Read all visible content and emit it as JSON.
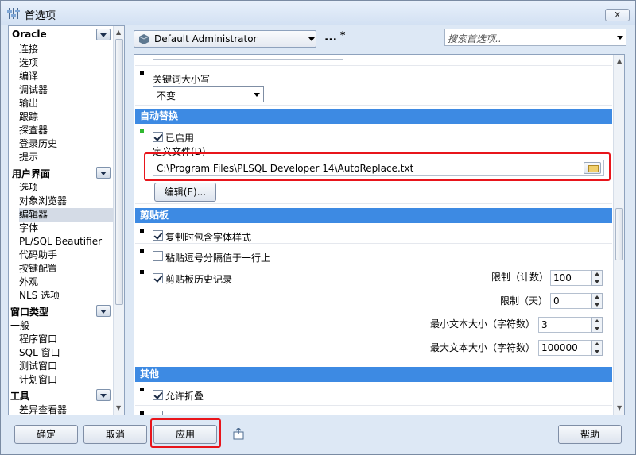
{
  "window": {
    "title": "首选项",
    "close": "x"
  },
  "tree": {
    "groups": [
      {
        "label": "Oracle",
        "items": [
          "连接",
          "选项",
          "编译",
          "调试器",
          "输出",
          "跟踪",
          "探查器",
          "登录历史",
          "提示"
        ]
      },
      {
        "label": "用户界面",
        "items": [
          "选项",
          "对象浏览器",
          "编辑器",
          "字体",
          "PL/SQL Beautifier",
          "代码助手",
          "按键配置",
          "外观",
          "NLS 选项"
        ]
      },
      {
        "label": "窗口类型",
        "items": [
          "一般",
          "程序窗口",
          "SQL 窗口",
          "测试窗口",
          "计划窗口"
        ]
      },
      {
        "label": "工具",
        "items": [
          "差异查看器"
        ]
      }
    ],
    "selected": "编辑器"
  },
  "toolbar": {
    "profile": "Default Administrator",
    "more": "...",
    "modified_marker": "*",
    "search_placeholder": "搜索首选项.."
  },
  "panel": {
    "keyword_case_label": "关键词大小写",
    "keyword_case_value": "不变",
    "autoreplace": {
      "header": "自动替换",
      "enabled_label": "已启用",
      "enabled": true,
      "file_label": "定义文件(D)",
      "file_value": "C:\\Program Files\\PLSQL Developer 14\\AutoReplace.txt",
      "edit_button": "编辑(E)..."
    },
    "clipboard": {
      "header": "剪贴板",
      "copy_font_label": "复制时包含字体样式",
      "copy_font": true,
      "paste_comma_label": "粘贴逗号分隔值于一行上",
      "paste_comma": false,
      "history_label": "剪贴板历史记录",
      "history": true,
      "limit_count_label": "限制（计数）",
      "limit_count": "100",
      "limit_days_label": "限制（天）",
      "limit_days": "0",
      "min_size_label": "最小文本大小（字符数）",
      "min_size": "3",
      "max_size_label": "最大文本大小（字符数）",
      "max_size": "100000"
    },
    "other": {
      "header": "其他",
      "allow_fold_label": "允许折叠",
      "allow_fold": true
    }
  },
  "buttons": {
    "ok": "确定",
    "cancel": "取消",
    "apply": "应用",
    "help": "帮助"
  }
}
